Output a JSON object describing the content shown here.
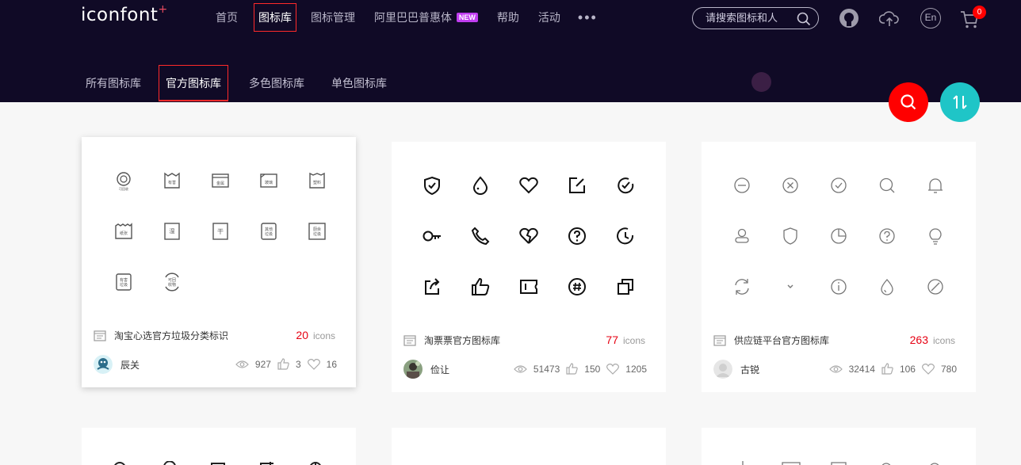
{
  "header": {
    "logo": "iconfont",
    "logo_plus": "+",
    "nav": [
      "首页",
      "图标库",
      "图标管理",
      "阿里巴巴普惠体",
      "帮助",
      "活动"
    ],
    "new_badge": "NEW",
    "more": "•••",
    "search_placeholder": "请搜索图标和人",
    "lang": "En",
    "cart_count": "0"
  },
  "subnav": [
    "所有图标库",
    "官方图标库",
    "多色图标库",
    "单色图标库"
  ],
  "cards": [
    {
      "title": "淘宝心选官方垃圾分类标识",
      "count": "20",
      "unit": "icons",
      "author": "辰关",
      "views": "927",
      "likes": "3",
      "favs": "16"
    },
    {
      "title": "淘票票官方图标库",
      "count": "77",
      "unit": "icons",
      "author": "俭让",
      "views": "51473",
      "likes": "150",
      "favs": "1205"
    },
    {
      "title": "供应链平台官方图标库",
      "count": "263",
      "unit": "icons",
      "author": "古锐",
      "views": "32414",
      "likes": "106",
      "favs": "780"
    }
  ],
  "colors": {
    "header_bg": "#100a26",
    "accent_red": "#ff0000",
    "fab_teal": "#1fc5c7",
    "count_red": "#e60012"
  }
}
